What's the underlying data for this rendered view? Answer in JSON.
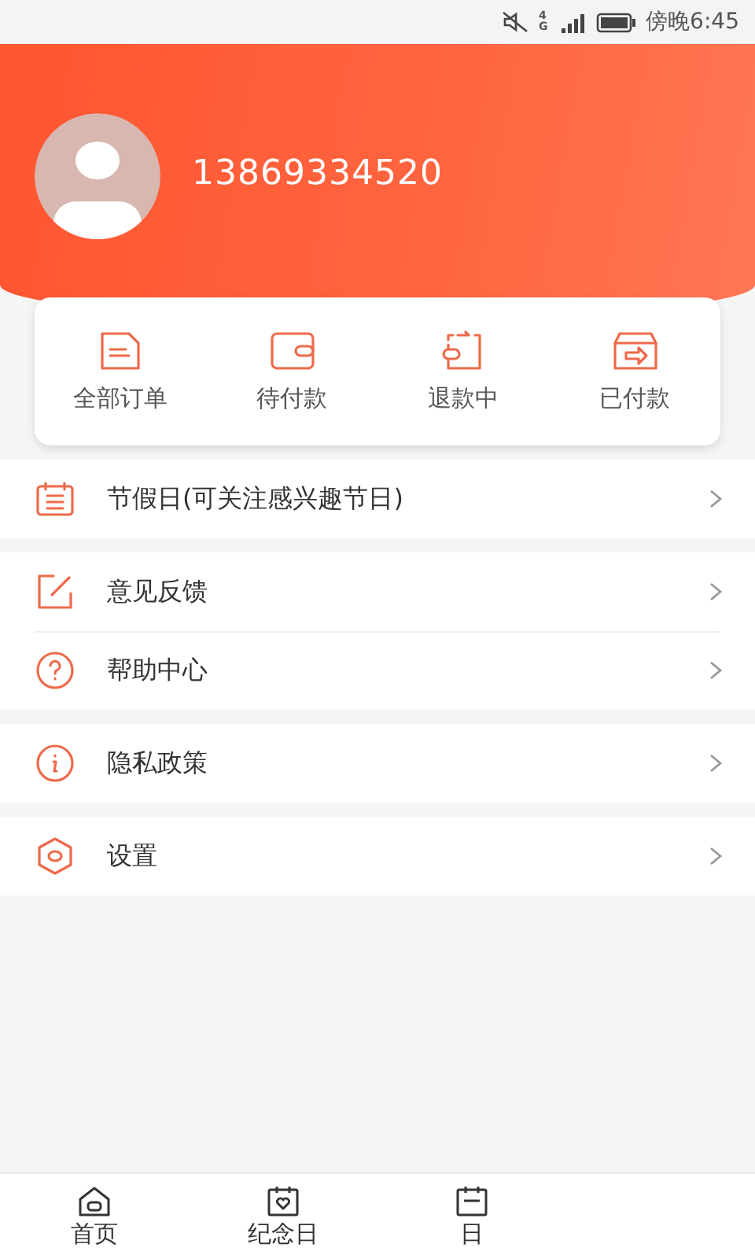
{
  "status_bar": {
    "time": "傍晚6:45",
    "network": "4G"
  },
  "profile": {
    "phone": "13869334520"
  },
  "orders": [
    {
      "kind": "all",
      "label": "全部订单"
    },
    {
      "kind": "unpaid",
      "label": "待付款"
    },
    {
      "kind": "refund",
      "label": "退款中"
    },
    {
      "kind": "paid",
      "label": "已付款"
    }
  ],
  "menu_groups": [
    [
      {
        "kind": "calendar",
        "label": "节假日(可关注感兴趣节日)"
      }
    ],
    [
      {
        "kind": "edit",
        "label": "意见反馈"
      },
      {
        "kind": "help",
        "label": "帮助中心"
      }
    ],
    [
      {
        "kind": "info",
        "label": "隐私政策"
      }
    ],
    [
      {
        "kind": "settings",
        "label": "设置"
      }
    ]
  ],
  "tabs": [
    {
      "kind": "home",
      "label": "首页",
      "selected": false
    },
    {
      "kind": "anniversary",
      "label": "纪念日",
      "selected": false
    },
    {
      "kind": "calendar",
      "label": "日",
      "selected": false
    }
  ]
}
